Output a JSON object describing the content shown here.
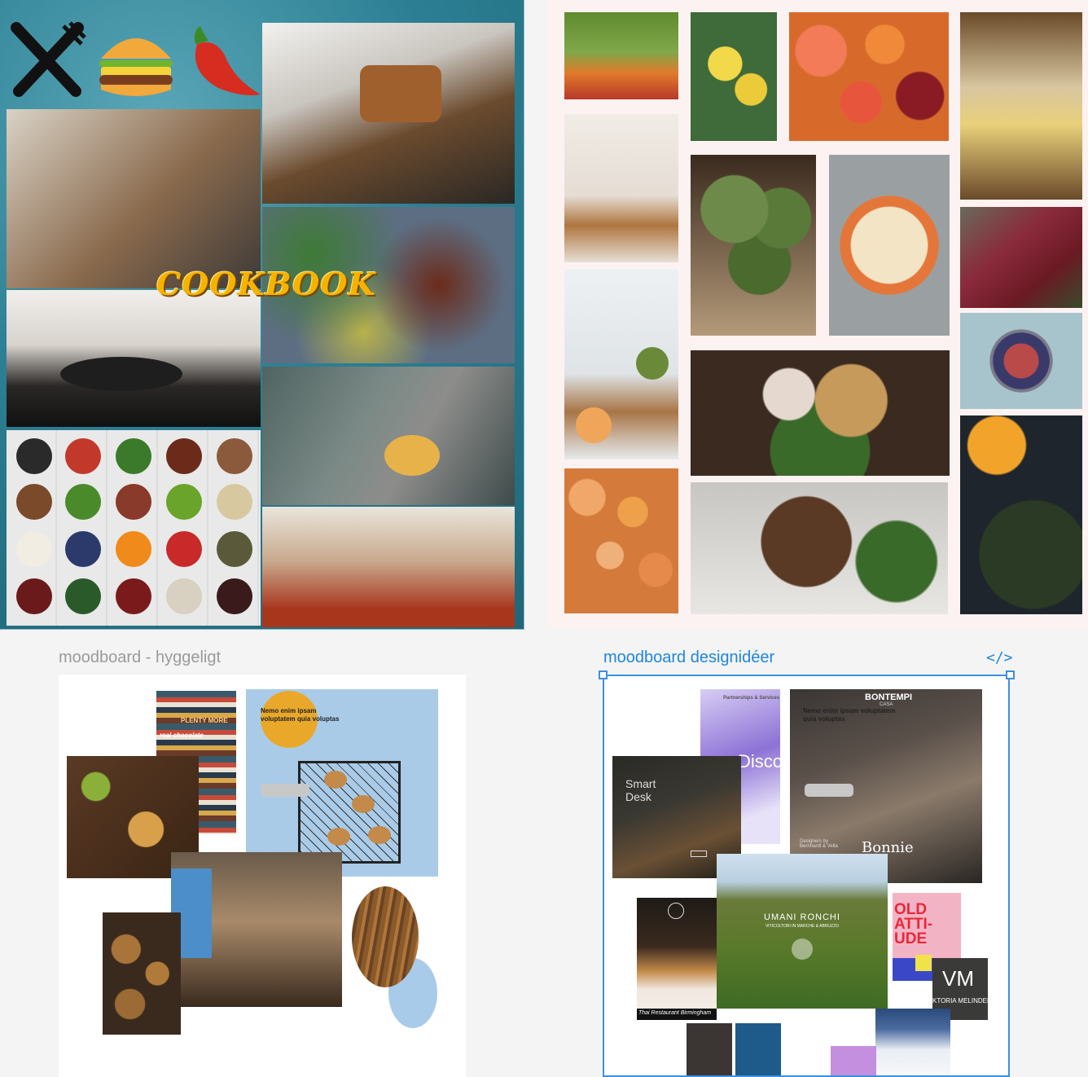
{
  "frames": {
    "hyggeligt": {
      "label": "moodboard - hyggeligt"
    },
    "designideer": {
      "label": "moodboard designidéer",
      "code_icon": "</>"
    }
  },
  "cookbook": {
    "title": "COOKBOOK",
    "icons": [
      "fork-knife-icon",
      "burger-icon",
      "chili-pepper-icon"
    ]
  },
  "hygge": {
    "caption": "Nemo enim ipsam voluptatem quia voluptas",
    "book_spines": [
      "PLENTY MORE",
      "real chocolate"
    ]
  },
  "design": {
    "bontempi": "BONTEMPI",
    "bontempi_sub": "CASA",
    "bonnie": "Bonnie",
    "smart_desk": "Smart Desk",
    "umani_title": "UMANI RONCHI",
    "umani_sub": "VITICOLTORI IN MARCHE & ABRUZZO",
    "discover": "Discov",
    "partnerships": "Partnerships & Services",
    "old_attitude": "OLD ATTI- UDE",
    "vm_logo": "VM",
    "viktoria": "KTORIA MELINDER",
    "thai": "Thai Restaurant Birmingham",
    "caption": "Nemo enim ipsam voluptatem quia voluptas",
    "designers": "Designers by Bernhardt & Vella"
  },
  "colors": {
    "accent": "#1f86dd",
    "frame_label": "#9a9a9a",
    "swatch_dark": "#3b3533",
    "swatch_blue": "#1e5a8a",
    "swatch_pink": "#c58fe0",
    "ellipse_blue": "#a9cbea"
  }
}
